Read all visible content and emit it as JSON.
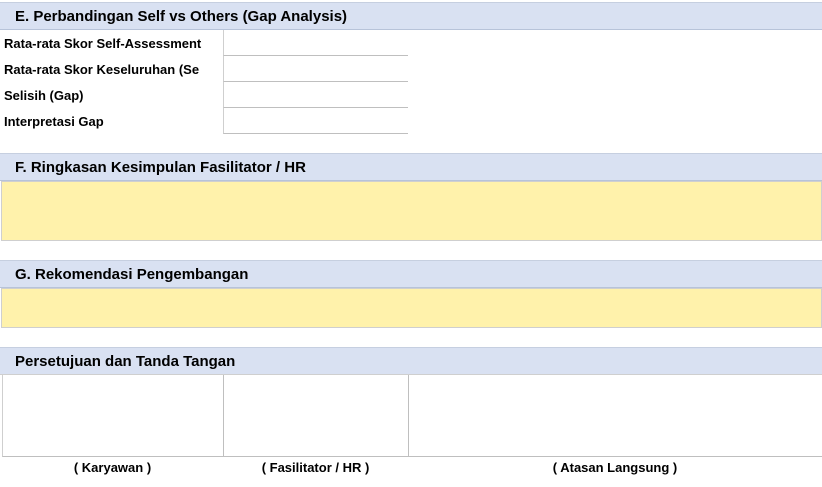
{
  "sections": {
    "e_title": "E. Perbandingan Self vs Others (Gap Analysis)",
    "f_title": "F. Ringkasan Kesimpulan Fasilitator / HR",
    "g_title": "G. Rekomendasi Pengembangan",
    "sign_title": "Persetujuan dan Tanda Tangan"
  },
  "gap_analysis": {
    "rows": [
      {
        "label": "Rata-rata Skor Self-Assessment",
        "value": ""
      },
      {
        "label": "Rata-rata Skor Keseluruhan (Se",
        "value": ""
      },
      {
        "label": "Selisih (Gap)",
        "value": ""
      },
      {
        "label": "Interpretasi Gap",
        "value": ""
      }
    ]
  },
  "facilitator_summary": {
    "value": ""
  },
  "development_recommendation": {
    "value": ""
  },
  "signatures": {
    "employee": "( Karyawan )",
    "facilitator": "( Fasilitator / HR )",
    "supervisor": "( Atasan Langsung )"
  },
  "colors": {
    "header_bg": "#d9e1f2",
    "input_bg": "#fff2ab"
  }
}
